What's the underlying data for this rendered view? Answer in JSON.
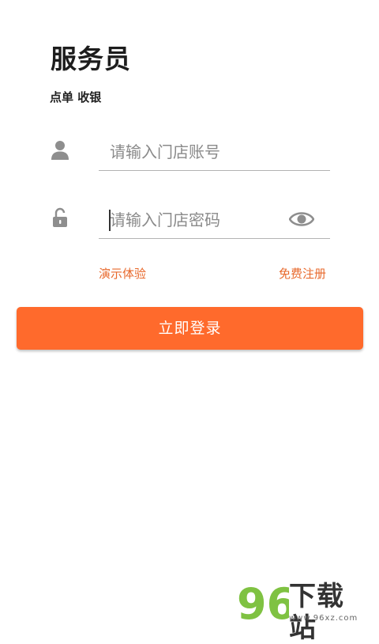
{
  "header": {
    "title": "服务员",
    "subtitle": "点单 收银"
  },
  "form": {
    "account_placeholder": "请输入门店账号",
    "password_placeholder": "请输入门店密码",
    "account_icon": "user-icon",
    "password_icon": "unlock-icon",
    "toggle_icon": "eye-icon"
  },
  "links": {
    "demo": "演示体验",
    "register": "免费注册"
  },
  "login_button": "立即登录",
  "watermark": {
    "name": "下载站",
    "logo_number": "96",
    "url": "www.96xz.com"
  },
  "colors": {
    "accent": "#ff6a2c",
    "link": "#e8692c",
    "icon": "#8e8e8e",
    "logo_green": "#7fc242"
  }
}
